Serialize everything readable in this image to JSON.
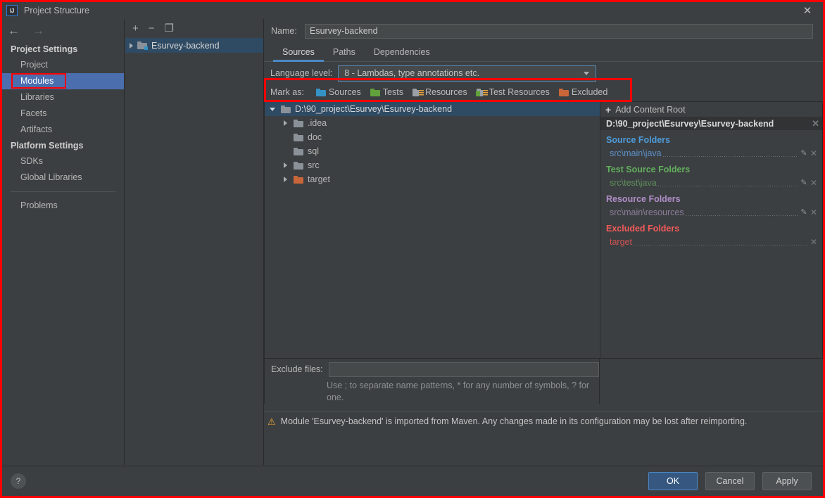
{
  "window": {
    "title": "Project Structure",
    "logo_text": "IJ",
    "close_label": "✕"
  },
  "sidebar": {
    "back_label": "←",
    "forward_label": "→",
    "groups": [
      {
        "title": "Project Settings",
        "items": [
          {
            "label": "Project",
            "selected": false
          },
          {
            "label": "Modules",
            "selected": true
          },
          {
            "label": "Libraries",
            "selected": false
          },
          {
            "label": "Facets",
            "selected": false
          },
          {
            "label": "Artifacts",
            "selected": false
          }
        ]
      },
      {
        "title": "Platform Settings",
        "items": [
          {
            "label": "SDKs",
            "selected": false
          },
          {
            "label": "Global Libraries",
            "selected": false
          }
        ]
      }
    ],
    "problems_label": "Problems"
  },
  "modules_panel": {
    "toolbar": {
      "add_label": "+",
      "remove_label": "−",
      "copy_label": "❐"
    },
    "tree": [
      {
        "label": "Esurvey-backend",
        "selected": true,
        "expandable": true
      }
    ]
  },
  "main": {
    "name_label": "Name:",
    "name_value": "Esurvey-backend",
    "tabs": [
      {
        "label": "Sources",
        "active": true
      },
      {
        "label": "Paths",
        "active": false
      },
      {
        "label": "Dependencies",
        "active": false
      }
    ],
    "language_level": {
      "label": "Language level:",
      "value": "8 - Lambdas, type annotations etc."
    },
    "mark_as": {
      "label": "Mark as:",
      "items": [
        {
          "label": "Sources",
          "color": "#3592c4",
          "kind": "plain"
        },
        {
          "label": "Tests",
          "color": "#62a23c",
          "kind": "plain"
        },
        {
          "label": "Resources",
          "color": "#9aa0a6",
          "kind": "resources"
        },
        {
          "label": "Test Resources",
          "color": "#9aa0a6",
          "kind": "test-resources"
        },
        {
          "label": "Excluded",
          "color": "#c8663a",
          "kind": "plain"
        }
      ]
    },
    "file_tree": [
      {
        "label": "D:\\90_project\\Esurvey\\Esurvey-backend",
        "depth": 0,
        "twisty": "down",
        "color": "#8a9199",
        "selected": true
      },
      {
        "label": ".idea",
        "depth": 1,
        "twisty": "right",
        "color": "#8a9199",
        "selected": false
      },
      {
        "label": "doc",
        "depth": 1,
        "twisty": "none",
        "color": "#8a9199",
        "selected": false
      },
      {
        "label": "sql",
        "depth": 1,
        "twisty": "none",
        "color": "#8a9199",
        "selected": false
      },
      {
        "label": "src",
        "depth": 1,
        "twisty": "right",
        "color": "#8a9199",
        "selected": false
      },
      {
        "label": "target",
        "depth": 1,
        "twisty": "right",
        "color": "#c8663a",
        "selected": false
      }
    ],
    "exclude": {
      "label": "Exclude files:",
      "value": "",
      "hint": "Use ; to separate name patterns, * for any number of symbols, ? for one."
    },
    "warning": {
      "icon": "⚠",
      "text": "Module 'Esurvey-backend' is imported from Maven. Any changes made in its configuration may be lost after reimporting."
    }
  },
  "detail_panel": {
    "add_content_root_label": "Add Content Root",
    "add_plus": "+",
    "root_path": "D:\\90_project\\Esurvey\\Esurvey-backend",
    "root_close": "✕",
    "sections": [
      {
        "title": "Source Folders",
        "title_color": "#4e9bdc",
        "entries": [
          {
            "path": "src\\main\\java",
            "color": "#5b8fc9",
            "has_edit": true,
            "has_remove": true
          }
        ]
      },
      {
        "title": "Test Source Folders",
        "title_color": "#62b05e",
        "entries": [
          {
            "path": "src\\test\\java",
            "color": "#5d8f5b",
            "has_edit": true,
            "has_remove": true
          }
        ]
      },
      {
        "title": "Resource Folders",
        "title_color": "#b08ec9",
        "entries": [
          {
            "path": "src\\main\\resources",
            "color": "#8c7d9b",
            "has_edit": true,
            "has_remove": true
          }
        ]
      },
      {
        "title": "Excluded Folders",
        "title_color": "#f25a5a",
        "entries": [
          {
            "path": "target",
            "color": "#cc5252",
            "has_edit": false,
            "has_remove": true
          }
        ]
      }
    ]
  },
  "footer": {
    "help_label": "?",
    "ok_label": "OK",
    "cancel_label": "Cancel",
    "apply_label": "Apply"
  },
  "annotations": {
    "accent_red": "#fd0000",
    "selection_blue": "#4b6eaf"
  }
}
